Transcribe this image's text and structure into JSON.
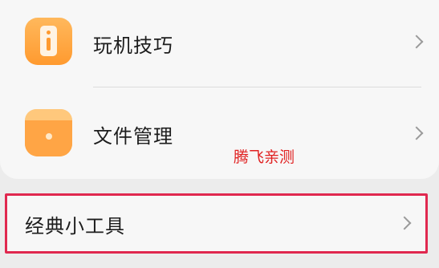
{
  "menu": {
    "items": [
      {
        "label": "玩机技巧",
        "icon": "info-icon"
      },
      {
        "label": "文件管理",
        "icon": "folder-icon"
      }
    ]
  },
  "watermark": "腾飞亲测",
  "tools": {
    "label": "经典小工具"
  },
  "colors": {
    "icon_orange": "#ff9a2f",
    "highlight_border": "#e0284f",
    "watermark_red": "#e02020",
    "chevron_gray": "#9a9a9a"
  }
}
